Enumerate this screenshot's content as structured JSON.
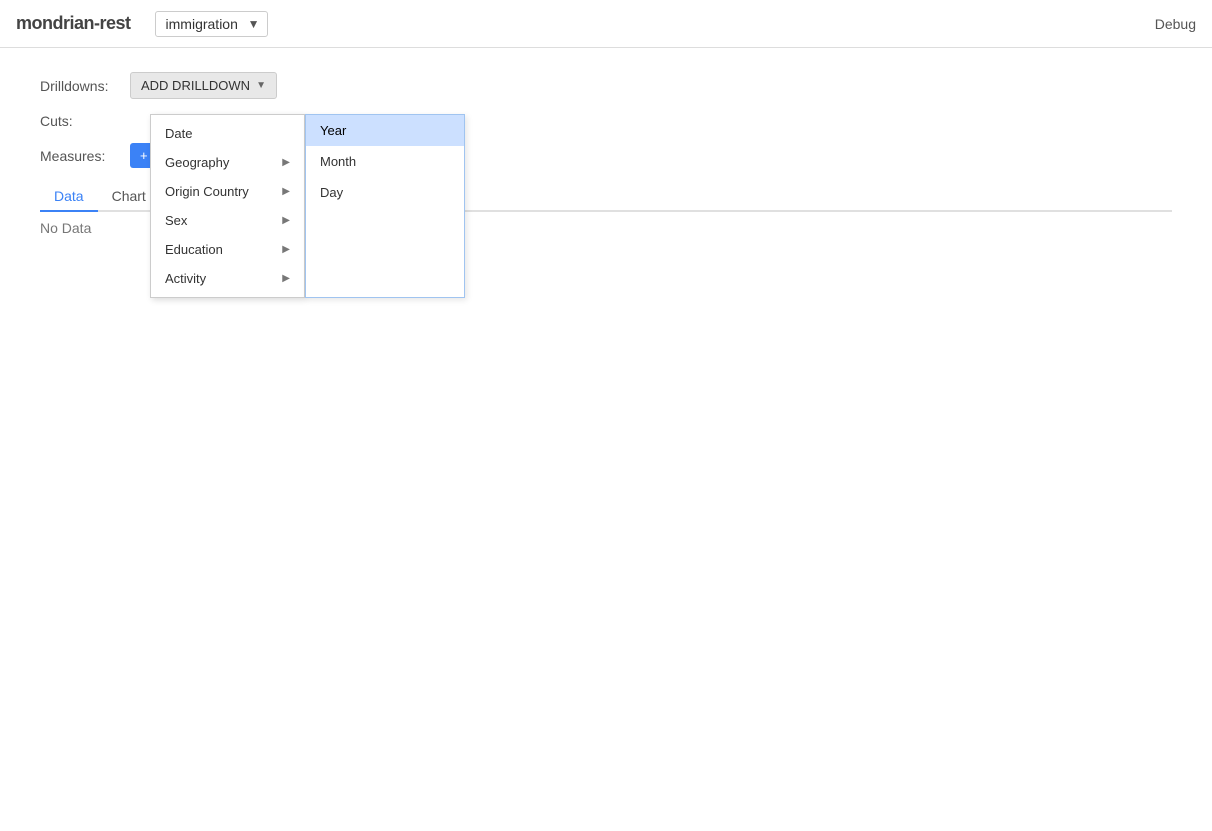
{
  "navbar": {
    "brand": "mondrian-rest",
    "cube_select": {
      "value": "immigration",
      "options": [
        "immigration"
      ]
    },
    "debug_label": "Debug"
  },
  "sidebar": {
    "drilldowns_label": "Drilldowns:",
    "cuts_label": "Cuts:",
    "measures_label": "Measures:",
    "add_drilldown_button": "ADD DRILLDOWN",
    "tabs": [
      {
        "label": "Data",
        "active": true
      },
      {
        "label": "Chart",
        "active": false
      }
    ],
    "no_data": "No Data"
  },
  "dropdown": {
    "items": [
      {
        "label": "Date",
        "has_submenu": false
      },
      {
        "label": "Geography",
        "has_submenu": true
      },
      {
        "label": "Origin Country",
        "has_submenu": true
      },
      {
        "label": "Sex",
        "has_submenu": true
      },
      {
        "label": "Education",
        "has_submenu": true
      },
      {
        "label": "Activity",
        "has_submenu": true
      }
    ]
  },
  "submenu": {
    "items": [
      {
        "label": "Year",
        "highlighted": true
      },
      {
        "label": "Month",
        "highlighted": false
      },
      {
        "label": "Day",
        "highlighted": false
      }
    ]
  }
}
